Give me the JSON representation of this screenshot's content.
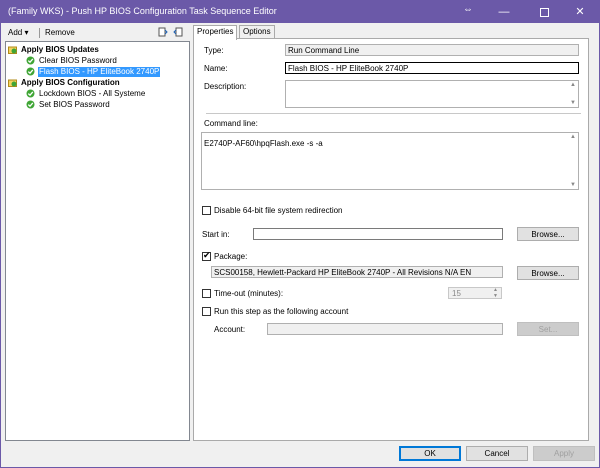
{
  "window": {
    "title": "(Family WKS) - Push HP BIOS Configuration Task Sequence Editor",
    "resize_glyph": "⇔",
    "minimize": "—",
    "close": "✕"
  },
  "toolbar": {
    "add_label": "Add ▾",
    "remove_label": "Remove"
  },
  "tree": {
    "items": [
      {
        "label": "Apply BIOS Updates",
        "type": "group"
      },
      {
        "label": "Clear BIOS Password",
        "type": "step"
      },
      {
        "label": "Flash BIOS - HP EliteBook 2740P",
        "type": "step",
        "selected": true
      },
      {
        "label": "Apply BIOS Configuration",
        "type": "group"
      },
      {
        "label": "Lockdown BIOS - All Systeme",
        "type": "step"
      },
      {
        "label": "Set BIOS Password",
        "type": "step"
      }
    ]
  },
  "tabs": [
    {
      "label": "Properties",
      "active": true
    },
    {
      "label": "Options",
      "active": false
    }
  ],
  "properties": {
    "type_label": "Type:",
    "type_value": "Run Command Line",
    "name_label": "Name:",
    "name_value": "Flash BIOS - HP EliteBook 2740P",
    "description_label": "Description:",
    "description_value": "",
    "command_line_label": "Command line:",
    "command_line_value": "E2740P-AF60\\hpqFlash.exe -s -a",
    "disable_redirection_label": "Disable 64-bit file system redirection",
    "disable_redirection_checked": false,
    "start_in_label": "Start in:",
    "start_in_value": "",
    "browse_label": "Browse...",
    "package_label": "Package:",
    "package_checked": true,
    "package_value": "SCS00158, Hewlett-Packard HP EliteBook 2740P - All Revisions N/A EN",
    "timeout_label": "Time-out (minutes):",
    "timeout_checked": false,
    "timeout_value": "15",
    "run_as_label": "Run this step as the following account",
    "run_as_checked": false,
    "account_label": "Account:",
    "account_value": "",
    "set_label": "Set..."
  },
  "footer": {
    "ok_label": "OK",
    "cancel_label": "Cancel",
    "apply_label": "Apply"
  },
  "colors": {
    "titlebar": "#6b59a8",
    "selection": "#3399ff",
    "step_icon": "#3fa535"
  }
}
